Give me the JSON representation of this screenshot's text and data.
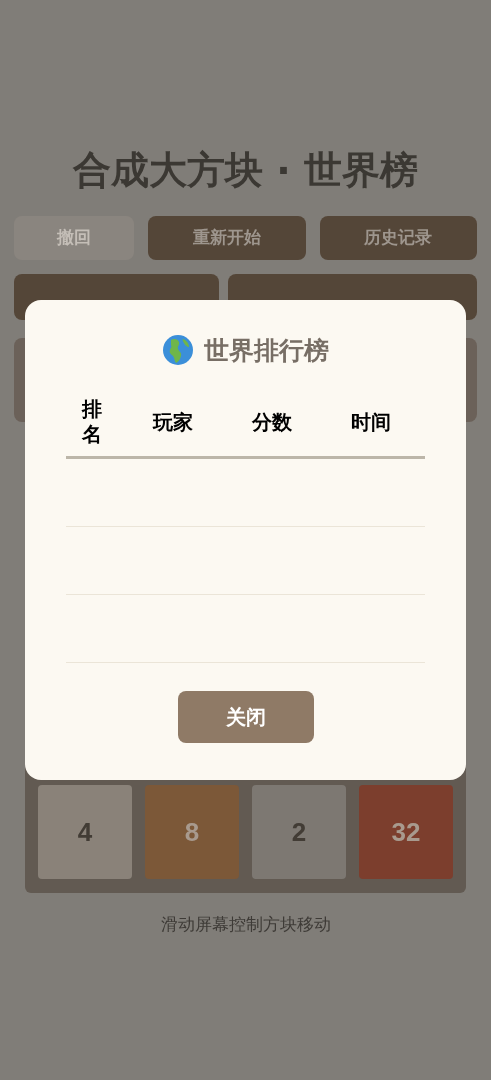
{
  "title": "合成大方块 · 世界榜",
  "buttons": [
    {
      "label": "撤回",
      "disabled": true
    },
    {
      "label": "重新开始",
      "disabled": false
    },
    {
      "label": "历史记录",
      "disabled": false
    }
  ],
  "nav_buttons": [
    {
      "kind": "wide"
    },
    {
      "kind": "wide"
    }
  ],
  "tiles": [
    {
      "value": "4",
      "color": "#8a8279",
      "kind": "dark_text"
    },
    {
      "value": "8",
      "color": "#7c5838",
      "kind": "light_text"
    },
    {
      "value": "2",
      "color": "#7d7872",
      "kind": "dark_text"
    },
    {
      "value": "32",
      "color": "#7c3e2d",
      "kind": "light_text"
    }
  ],
  "hint": "滑动屏幕控制方块移动",
  "dialog": {
    "title": "世界排行榜",
    "columns": [
      "排名",
      "玩家",
      "分数",
      "时间"
    ],
    "close_button": "关闭"
  }
}
